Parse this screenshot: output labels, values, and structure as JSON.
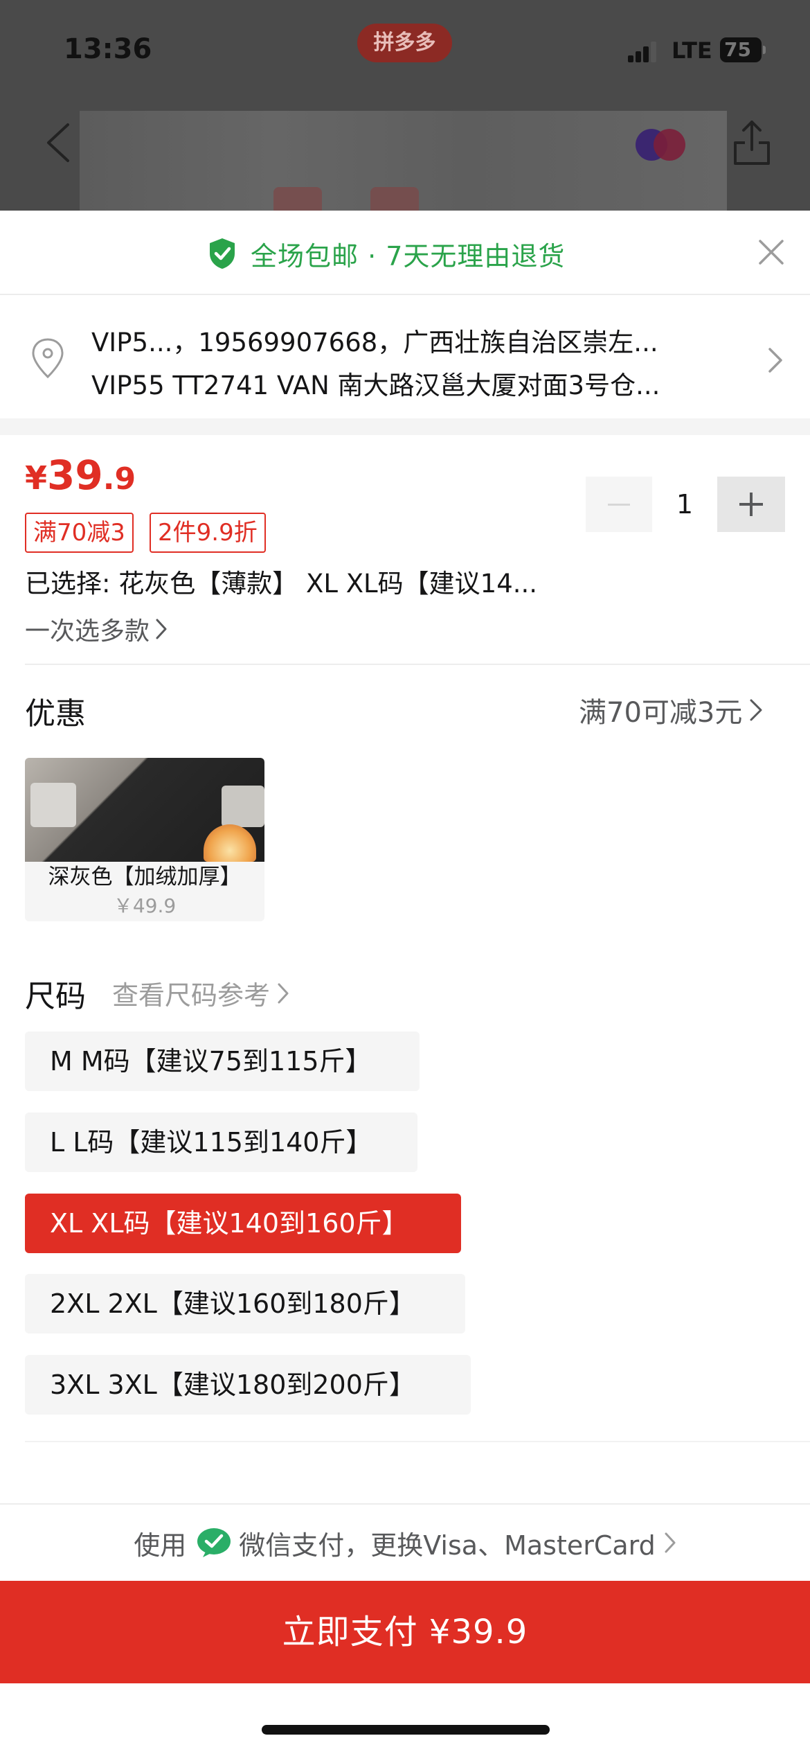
{
  "status_bar": {
    "time": "13:36",
    "carrier": "LTE",
    "battery": "75"
  },
  "header": {
    "brand_badge": "拼多多"
  },
  "promo_bar": {
    "text": "全场包邮 · 7天无理由退货",
    "accent_color": "#2aa34a"
  },
  "address": {
    "line1": "VIP5...，19569907668，广西壮族自治区崇左...",
    "line2": "VIP55 TT2741 VAN  南大路汉邕大厦对面3号仓..."
  },
  "price": {
    "currency": "¥",
    "integer": "39",
    "decimal": ".9",
    "color": "#e02e24"
  },
  "quantity": {
    "value": "1"
  },
  "coupons": [
    {
      "label": "满70减3"
    },
    {
      "label": "2件9.9折"
    }
  ],
  "selection": {
    "selected_text": "已选择: 花灰色【薄款】 XL XL码【建议14...",
    "multi_select_label": "一次选多款"
  },
  "discount": {
    "title": "优惠",
    "value": "满70可减3元"
  },
  "variants": [
    {
      "label": "深灰色【加绒加厚】",
      "price": "￥49.9"
    }
  ],
  "size": {
    "title": "尺码",
    "reference_link": "查看尺码参考",
    "options": [
      {
        "label": "M M码【建议75到115斤】",
        "selected": false
      },
      {
        "label": "L L码【建议115到140斤】",
        "selected": false
      },
      {
        "label": "XL XL码【建议140到160斤】",
        "selected": true
      },
      {
        "label": "2XL 2XL【建议160到180斤】",
        "selected": false
      },
      {
        "label": "3XL 3XL【建议180到200斤】",
        "selected": false
      }
    ]
  },
  "payment": {
    "prefix": "使用",
    "method_text": "微信支付，更换Visa、MasterCard",
    "pay_button": "立即支付 ¥39.9",
    "wechat_color": "#2aae67"
  }
}
